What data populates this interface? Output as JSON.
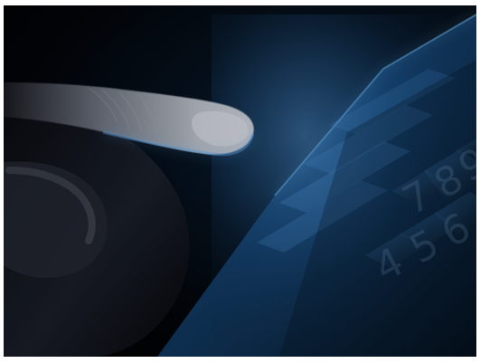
{
  "image": {
    "subject": "finger-touching-tablet-screen",
    "palette": {
      "background_dark": "#010203",
      "screen_blue": "#2d7fd0",
      "screen_glow": "#68b6ff",
      "skin_light": "#c8cdd6",
      "skin_shadow": "#3a3f4b"
    }
  },
  "screen": {
    "list_items": [
      {
        "text": ""
      },
      {
        "text": ""
      },
      {
        "text": ""
      },
      {
        "text": ""
      }
    ],
    "keypad": {
      "keys": [
        "7",
        "8",
        "9",
        "4",
        "5",
        "6"
      ]
    }
  }
}
